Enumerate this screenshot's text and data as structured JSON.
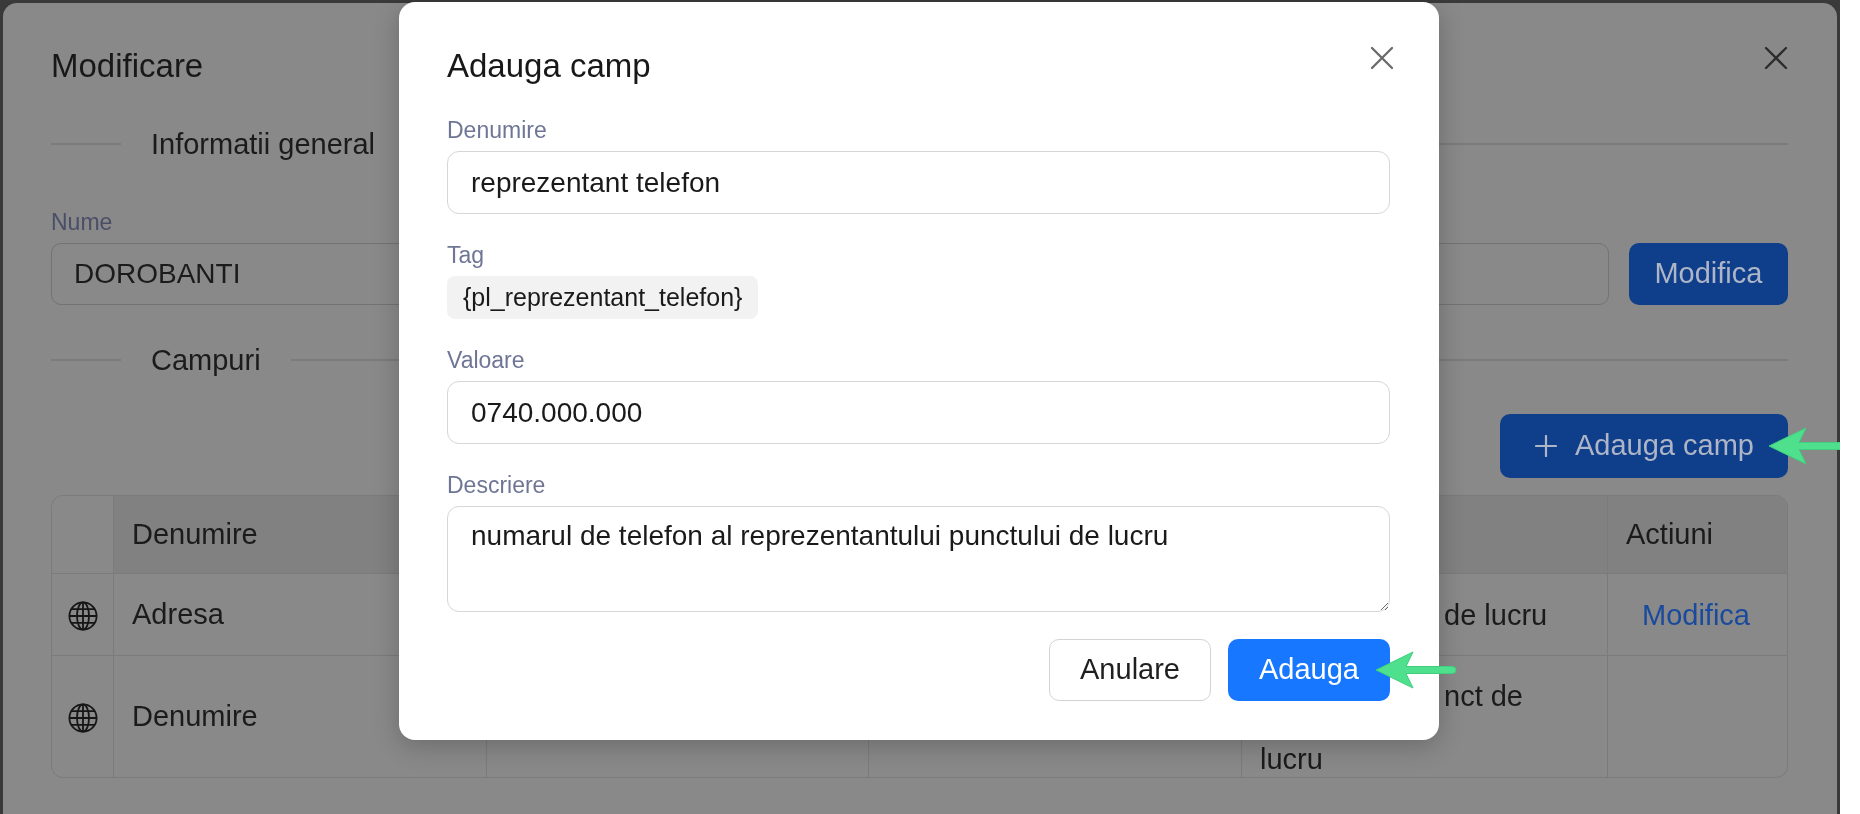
{
  "edit_dialog": {
    "title": "Modificare",
    "general_section": {
      "title": "Informatii general",
      "name_label": "Nume",
      "name_value": "DOROBANTI",
      "modify_button": "Modifica"
    },
    "fields_section": {
      "title": "Campuri",
      "add_button": "Adauga camp",
      "table": {
        "headers": {
          "column_1": "Denumire",
          "column_5": "Actiuni"
        },
        "rows": [
          {
            "column_1": "Adresa",
            "column_4": [
              "de lucru"
            ],
            "column_5": "Modifica"
          },
          {
            "column_1": "Denumire",
            "column_4": [
              "nct de",
              "lucru"
            ]
          }
        ]
      }
    }
  },
  "add_field_dialog": {
    "title": "Adauga camp",
    "fields": [
      {
        "kind": "input",
        "label": "Denumire",
        "value": "reprezentant telefon"
      },
      {
        "kind": "tag",
        "label": "Tag",
        "value": "{pl_reprezentant_telefon}"
      },
      {
        "kind": "input",
        "label": "Valoare",
        "value": "0740.000.000"
      },
      {
        "kind": "textarea",
        "label": "Descriere",
        "value": "numarul de telefon al reprezentantului punctului de lucru"
      }
    ],
    "buttons": [
      {
        "kind": "cancel",
        "label": "Anulare"
      },
      {
        "kind": "submit",
        "label": "Adauga"
      }
    ]
  }
}
